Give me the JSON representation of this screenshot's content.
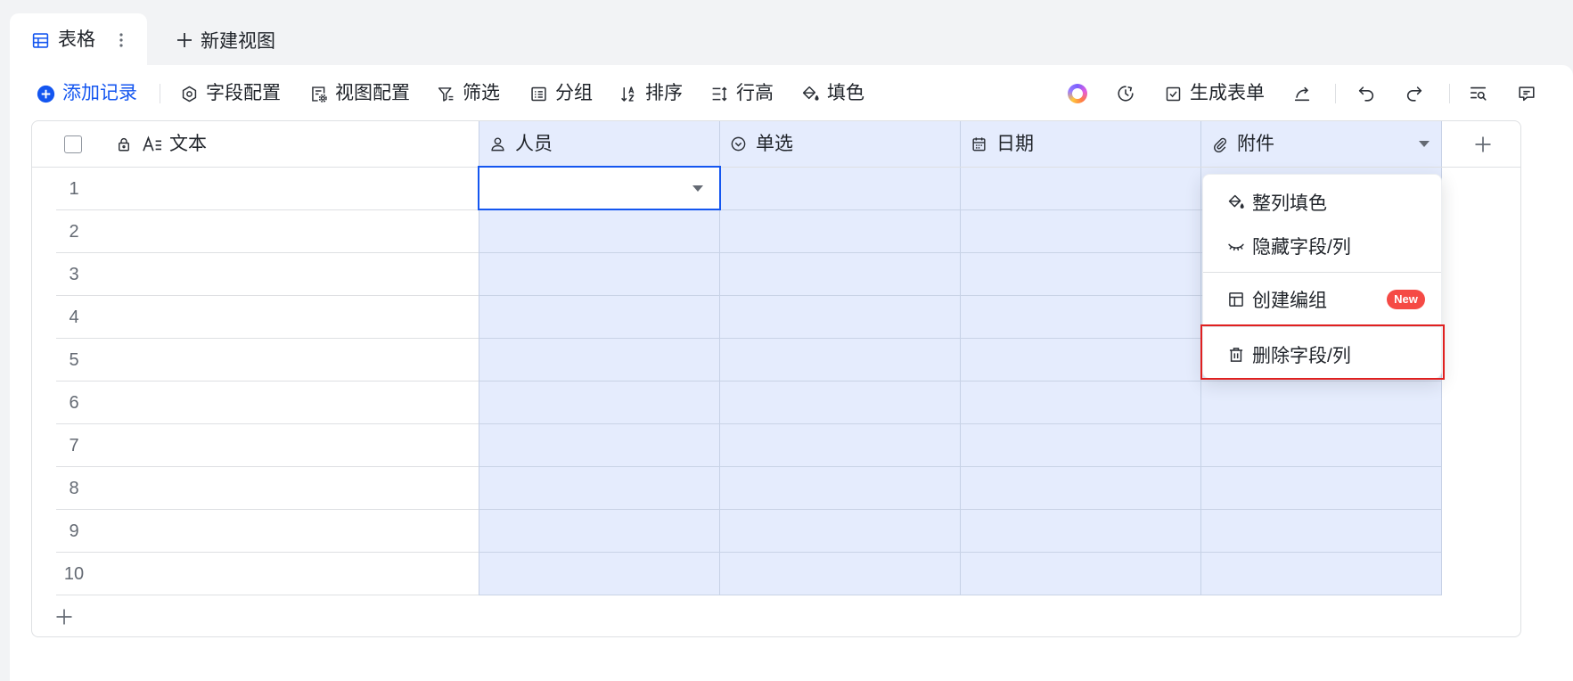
{
  "tabs": [
    {
      "label": "表格",
      "icon": "table-icon"
    }
  ],
  "new_view": {
    "label": "新建视图",
    "icon": "plus-icon"
  },
  "toolbar": {
    "add_record": "添加记录",
    "field_config": "字段配置",
    "view_config": "视图配置",
    "filter": "筛选",
    "group": "分组",
    "sort": "排序",
    "row_height": "行高",
    "fill_color": "填色",
    "generate_form": "生成表单",
    "right_icons": [
      "ai-assistant-icon",
      "history-icon",
      "share-icon",
      "undo-icon",
      "redo-icon",
      "find-icon",
      "comment-icon"
    ]
  },
  "table": {
    "columns": [
      {
        "label": "文本",
        "icon": "text-field-icon",
        "locked": true,
        "selected": false
      },
      {
        "label": "人员",
        "icon": "person-icon",
        "selected": true
      },
      {
        "label": "单选",
        "icon": "single-select-icon",
        "selected": true
      },
      {
        "label": "日期",
        "icon": "calendar-icon",
        "selected": true
      },
      {
        "label": "附件",
        "icon": "attachment-icon",
        "selected": true
      }
    ],
    "row_numbers": [
      "1",
      "2",
      "3",
      "4",
      "5",
      "6",
      "7",
      "8",
      "9",
      "10"
    ]
  },
  "column_menu": {
    "items": [
      {
        "label": "整列填色",
        "icon": "paint-bucket-icon"
      },
      {
        "label": "隐藏字段/列",
        "icon": "eye-closed-icon"
      },
      {
        "label": "创建编组",
        "icon": "layout-icon",
        "badge": "New"
      },
      {
        "label": "删除字段/列",
        "icon": "trash-icon",
        "highlighted": true
      }
    ]
  },
  "colors": {
    "accent": "#1456f0",
    "selection_fill": "#e5ecfd",
    "active_cell_border": "#1456f0",
    "badge": "#f54a45",
    "highlight_box": "#e02020"
  }
}
